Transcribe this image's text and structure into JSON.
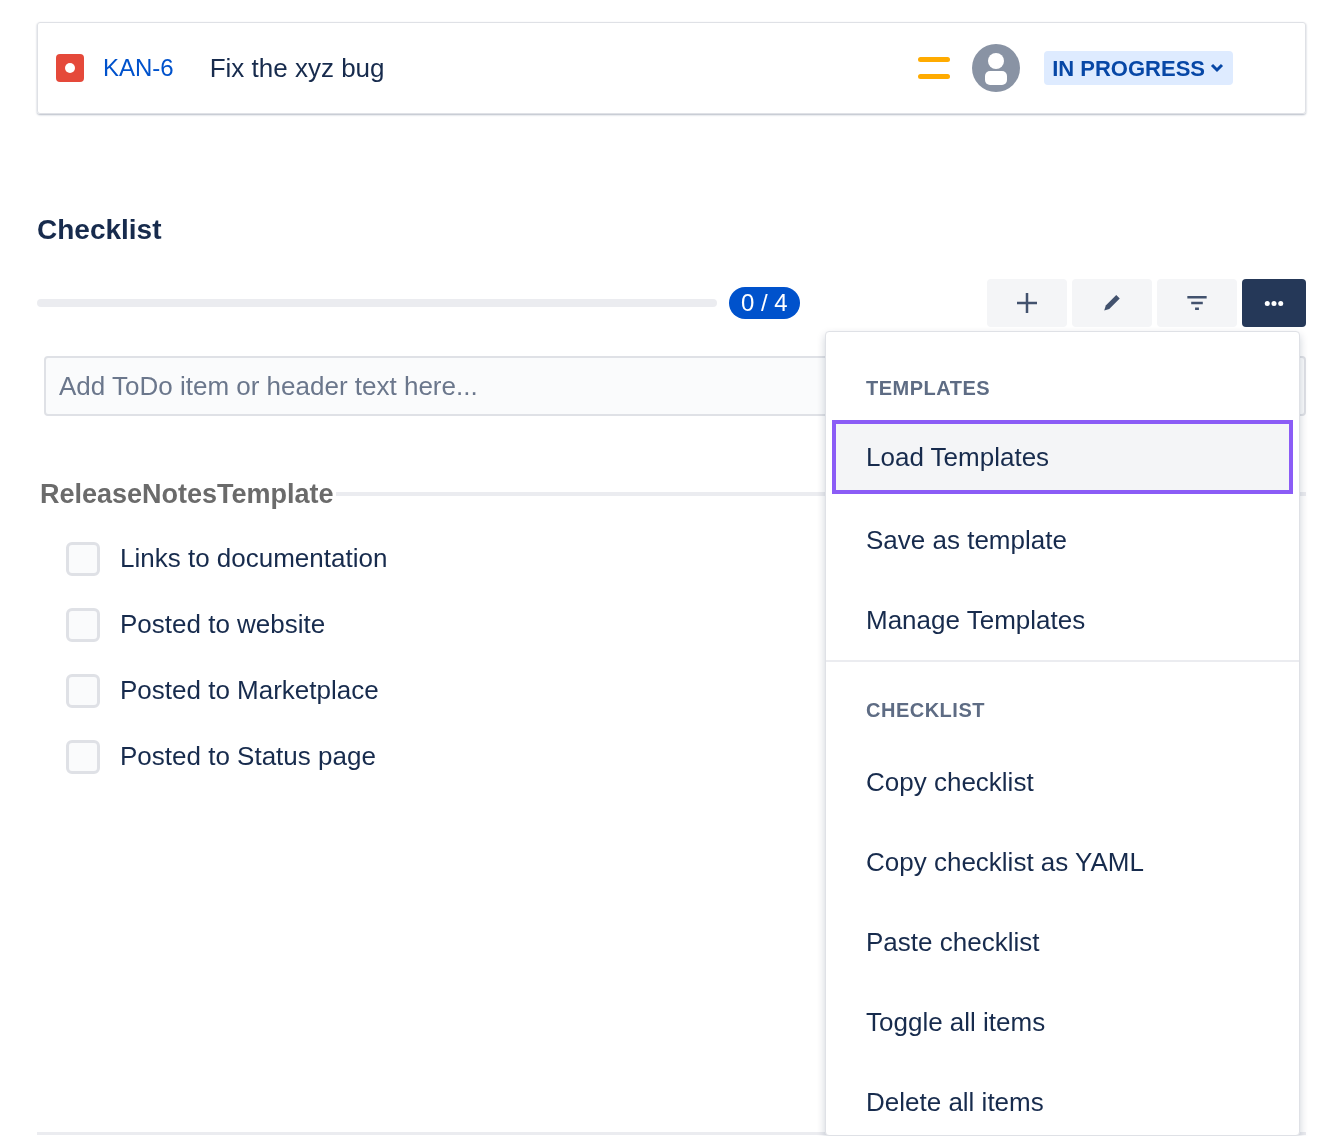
{
  "issue": {
    "key": "KAN-6",
    "summary": "Fix the xyz bug",
    "status": "IN PROGRESS"
  },
  "checklist": {
    "title": "Checklist",
    "progress": {
      "label": "0 / 4",
      "level": 0
    },
    "toolbar": [
      {
        "kind": "add",
        "selected": false
      },
      {
        "kind": "edit",
        "selected": false
      },
      {
        "kind": "filter",
        "selected": false
      },
      {
        "kind": "more",
        "selected": true
      }
    ],
    "input": {
      "placeholder": "Add ToDo item or header text here..."
    },
    "header": "ReleaseNotesTemplate",
    "items": [
      {
        "label": "Links to documentation",
        "checked": false
      },
      {
        "label": "Posted to website",
        "checked": false
      },
      {
        "label": "Posted to Marketplace",
        "checked": false
      },
      {
        "label": "Posted to Status page",
        "checked": false
      }
    ]
  },
  "menu": {
    "sections": [
      {
        "title": "TEMPLATES",
        "items": [
          {
            "label": "Load Templates",
            "selected": true
          },
          {
            "label": "Save as template",
            "selected": false
          },
          {
            "label": "Manage Templates",
            "selected": false
          }
        ]
      },
      {
        "title": "CHECKLIST",
        "items": [
          {
            "label": "Copy checklist",
            "selected": false
          },
          {
            "label": "Copy checklist as YAML",
            "selected": false
          },
          {
            "label": "Paste checklist",
            "selected": false
          },
          {
            "label": "Toggle all items",
            "selected": false
          },
          {
            "label": "Delete all items",
            "selected": false
          }
        ]
      }
    ]
  }
}
